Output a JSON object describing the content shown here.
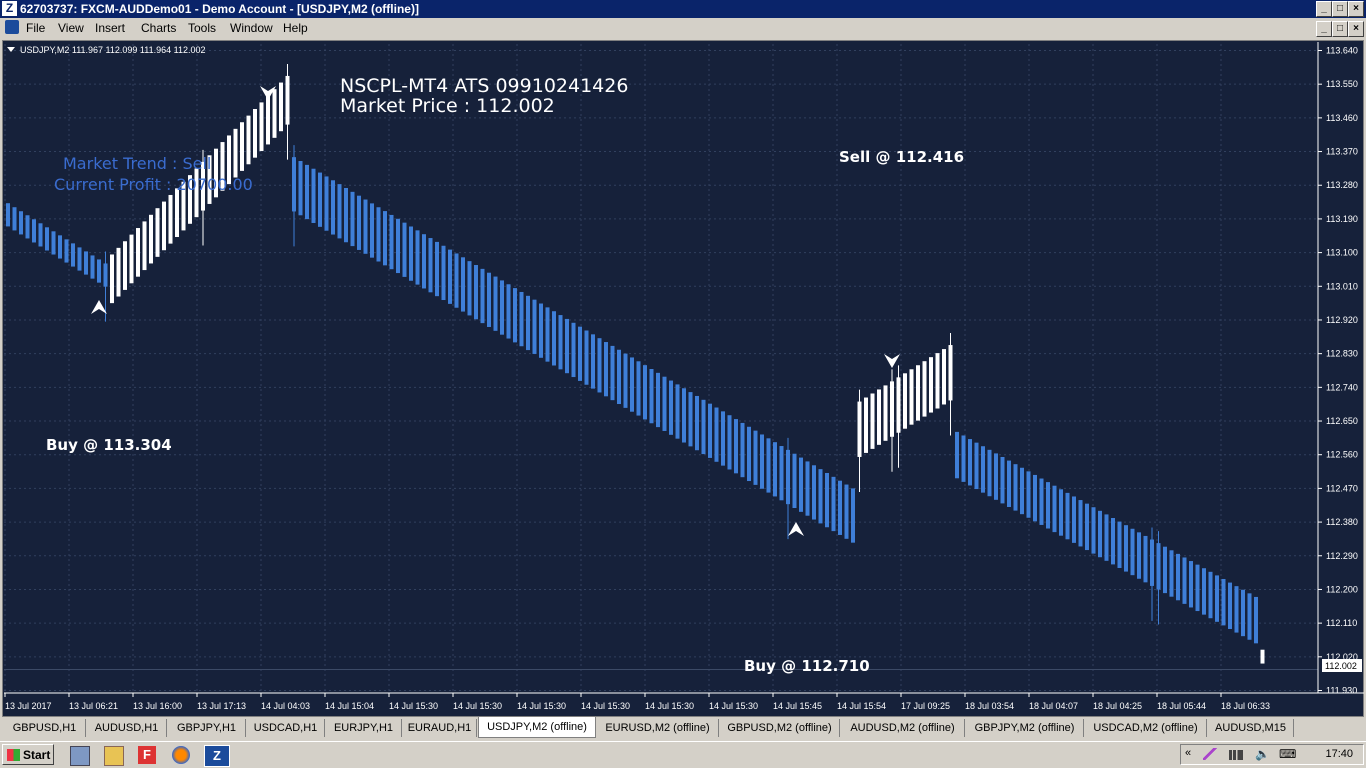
{
  "window": {
    "title": "62703737: FXCM-AUDDemo01 - Demo Account - [USDJPY,M2 (offline)]",
    "controls": [
      "_",
      "□",
      "×"
    ]
  },
  "menu": [
    "File",
    "View",
    "Insert",
    "Charts",
    "Tools",
    "Window",
    "Help"
  ],
  "chart": {
    "label": "USDJPY,M2  111.967 112.099 111.964 112.002",
    "header_line1": "NSCPL-MT4 ATS 09910241426",
    "header_line2": "Market Price : 112.002",
    "trend_line1": "Market Trend  :  Sell",
    "trend_line2": "Current Profit  :  20700.00",
    "sell_label": "Sell @ 112.416",
    "buy_label1": "Buy @ 113.304",
    "buy_label2": "Buy @ 112.710",
    "current_price_tag": "112.002",
    "colors": {
      "background": "#16213a",
      "bear": "#3f7fd8",
      "bull": "#ffffff",
      "grid": "#31405e",
      "trend_text": "#3a6ccf"
    }
  },
  "chart_data": {
    "type": "candlestick",
    "y_ticks": [
      "113.640",
      "113.550",
      "113.460",
      "113.370",
      "113.280",
      "113.190",
      "113.100",
      "113.010",
      "112.920",
      "112.830",
      "112.740",
      "112.650",
      "112.560",
      "112.470",
      "112.380",
      "112.290",
      "112.200",
      "112.110",
      "112.020",
      "111.930"
    ],
    "ylim": [
      111.93,
      113.64
    ],
    "x_ticks": [
      "13 Jul 2017",
      "13 Jul 06:21",
      "13 Jul 16:00",
      "13 Jul 17:13",
      "14 Jul 04:03",
      "14 Jul 15:04",
      "14 Jul 15:30",
      "14 Jul 15:30",
      "14 Jul 15:30",
      "14 Jul 15:30",
      "14 Jul 15:30",
      "14 Jul 15:30",
      "14 Jul 15:45",
      "14 Jul 15:54",
      "17 Jul 09:25",
      "18 Jul 03:54",
      "18 Jul 04:07",
      "18 Jul 04:25",
      "18 Jul 05:44",
      "18 Jul 06:33"
    ],
    "segments": [
      {
        "kind": "bear",
        "count": 16,
        "open_start": 113.232,
        "open_end": 113.071,
        "body": 0.062
      },
      {
        "kind": "bull",
        "count": 28,
        "close_start": 113.095,
        "close_end": 113.572,
        "body": 0.13
      },
      {
        "kind": "bear",
        "count": 87,
        "open_start": 113.355,
        "open_end": 112.47,
        "body": 0.145
      },
      {
        "kind": "bull",
        "count": 15,
        "close_start": 112.702,
        "close_end": 112.853,
        "body": 0.148
      },
      {
        "kind": "bear",
        "count": 47,
        "open_start": 112.621,
        "open_end": 112.18,
        "body": 0.124
      },
      {
        "kind": "bull",
        "count": 1,
        "close_start": 112.039,
        "close_end": 112.039,
        "body": 0.037
      }
    ],
    "markers": [
      {
        "type": "buy-arrow",
        "price": 113.304
      },
      {
        "type": "sell-arrow",
        "price": 112.416
      },
      {
        "type": "buy-arrow",
        "price": 112.71
      },
      {
        "type": "sell-arrow",
        "price": 112.82
      }
    ]
  },
  "tabs": [
    "GBPUSD,H1",
    "AUDUSD,H1",
    "GBPJPY,H1",
    "USDCAD,H1",
    "EURJPY,H1",
    "EURAUD,H1",
    "USDJPY,M2 (offline)",
    "EURUSD,M2 (offline)",
    "GBPUSD,M2 (offline)",
    "AUDUSD,M2 (offline)",
    "GBPJPY,M2 (offline)",
    "USDCAD,M2 (offline)",
    "AUDUSD,M15"
  ],
  "active_tab": 6,
  "taskbar": {
    "start": "Start",
    "clock": "17:40"
  }
}
